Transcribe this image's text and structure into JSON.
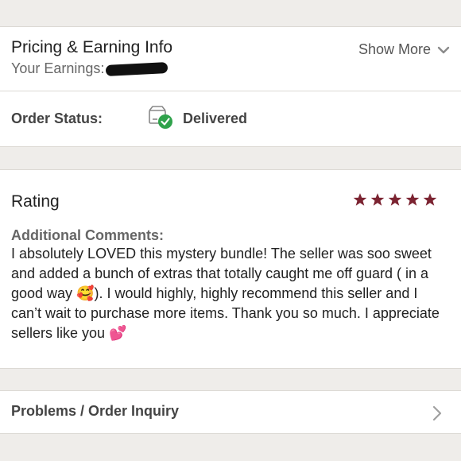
{
  "pricing": {
    "title": "Pricing & Earning Info",
    "earnings_label": "Your Earnings:",
    "show_more": "Show More"
  },
  "order": {
    "label": "Order Status:",
    "status": "Delivered"
  },
  "rating": {
    "title": "Rating",
    "stars": 5,
    "star_color": "#7b2331",
    "comments_label": "Additional Comments:",
    "comment_text_1": "I absolutely LOVED this mystery bundle! The seller was soo sweet and added a bunch of extras that totally caught me off guard ( in a good way ",
    "comment_emoji_1": "🥰",
    "comment_text_2": "). I would highly, highly recommend this seller and I can’t wait to purchase more items. Thank you so much. I appreciate sellers like you ",
    "comment_emoji_2": "💕"
  },
  "inquiry": {
    "label": "Problems / Order Inquiry"
  },
  "icons": {
    "delivered": "package-check-icon",
    "show_more": "chevron-down-icon",
    "inquiry": "chevron-right-icon",
    "rating": "star-icon"
  }
}
